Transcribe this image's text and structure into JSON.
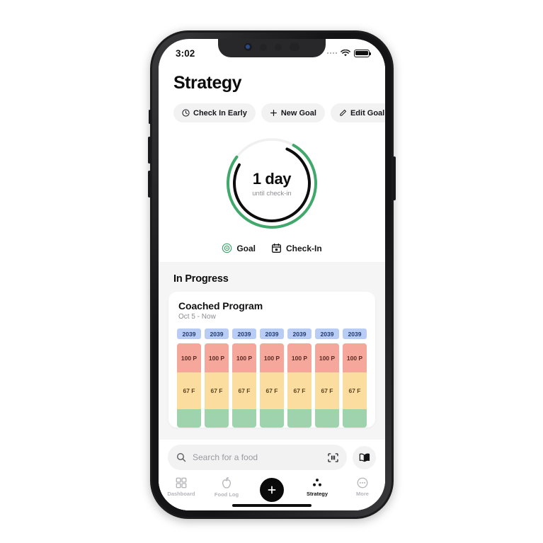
{
  "status_bar": {
    "time": "3:02",
    "signal_icon": "signal-dots-icon",
    "wifi_icon": "wifi-icon",
    "battery_icon": "battery-full-icon"
  },
  "header": {
    "title": "Strategy"
  },
  "chips": [
    {
      "label": "Check In Early",
      "icon": "clock-icon",
      "name": "chip-check-in-early"
    },
    {
      "label": "New Goal",
      "icon": "plus-icon",
      "name": "chip-new-goal"
    },
    {
      "label": "Edit Goal",
      "icon": "pencil-icon",
      "name": "chip-edit-goal"
    },
    {
      "label": "",
      "icon": "bar-chart-icon",
      "name": "chip-stats"
    }
  ],
  "ring": {
    "value": "1 day",
    "caption": "until check-in",
    "goal_color": "#3fa86a",
    "checkin_color": "#0d0d0d",
    "track_color": "#f0f0f0"
  },
  "legend": [
    {
      "label": "Goal",
      "icon": "target-icon",
      "color": "#3fa86a",
      "name": "legend-goal"
    },
    {
      "label": "Check-In",
      "icon": "calendar-icon",
      "color": "#121214",
      "name": "legend-check-in"
    }
  ],
  "in_progress": {
    "section_title": "In Progress",
    "card": {
      "title": "Coached Program",
      "subtitle": "Oct 5 - Now",
      "columns": [
        {
          "calories": "2039",
          "protein": "100 P",
          "fat": "67 F"
        },
        {
          "calories": "2039",
          "protein": "100 P",
          "fat": "67 F"
        },
        {
          "calories": "2039",
          "protein": "100 P",
          "fat": "67 F"
        },
        {
          "calories": "2039",
          "protein": "100 P",
          "fat": "67 F"
        },
        {
          "calories": "2039",
          "protein": "100 P",
          "fat": "67 F"
        },
        {
          "calories": "2039",
          "protein": "100 P",
          "fat": "67 F"
        },
        {
          "calories": "2039",
          "protein": "100 P",
          "fat": "67 F"
        }
      ],
      "colors": {
        "calorie_badge": "#b9cdf4",
        "protein": "#f5a79b",
        "fat": "#fbdda0",
        "carb": "#9ed3ae"
      }
    }
  },
  "search": {
    "placeholder": "Search for a food",
    "search_icon": "search-icon",
    "barcode_icon": "barcode-scan-icon",
    "book_icon": "recipe-book-icon"
  },
  "tabs": [
    {
      "label": "Dashboard",
      "icon": "grid-icon",
      "active": false,
      "name": "tab-dashboard"
    },
    {
      "label": "Food Log",
      "icon": "apple-icon",
      "active": false,
      "name": "tab-food-log"
    },
    {
      "label": "",
      "icon": "plus-icon",
      "active": false,
      "name": "tab-add-fab"
    },
    {
      "label": "Strategy",
      "icon": "dots-triangle-icon",
      "active": true,
      "name": "tab-strategy"
    },
    {
      "label": "More",
      "icon": "ellipsis-circle-icon",
      "active": false,
      "name": "tab-more"
    }
  ]
}
